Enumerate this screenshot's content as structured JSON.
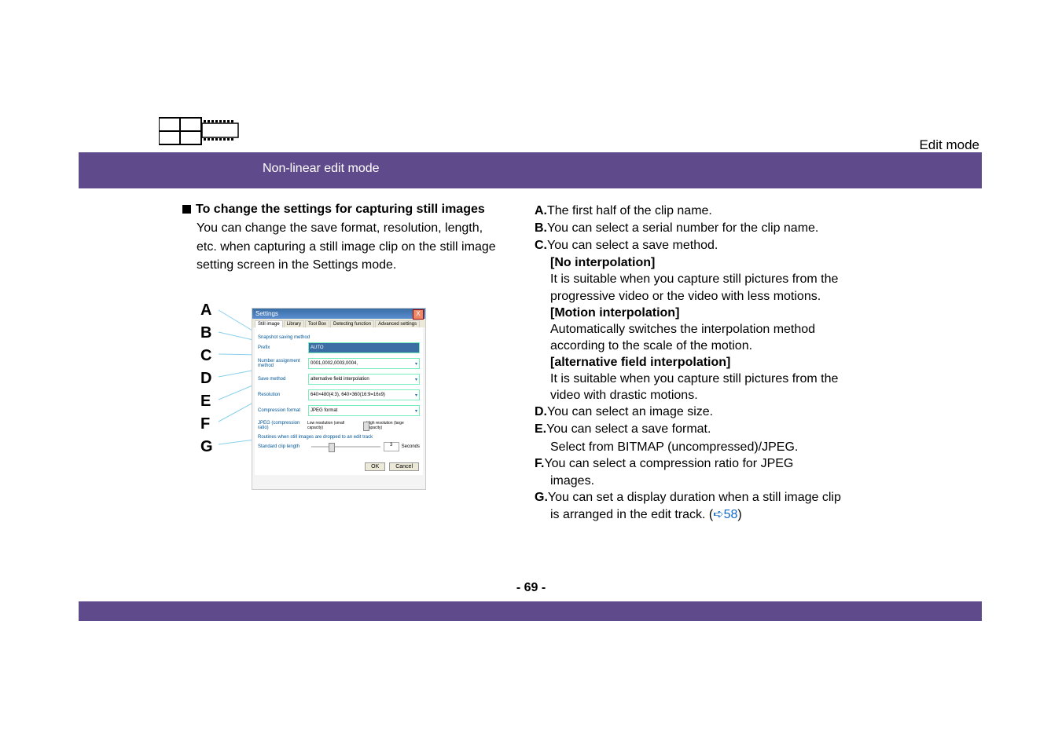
{
  "header": {
    "edit_mode": "Edit mode",
    "banner": "Non-linear edit mode"
  },
  "left": {
    "heading": "To change the settings for capturing still images",
    "para1": "You can change the save format, resolution, length,",
    "para2": "etc. when capturing a still image clip on the still image",
    "para3": "setting screen in the Settings mode."
  },
  "labels": {
    "A": "A",
    "B": "B",
    "C": "C",
    "D": "D",
    "E": "E",
    "F": "F",
    "G": "G"
  },
  "dialog": {
    "title": "Settings",
    "close": "X",
    "tabs": {
      "t1": "Still image",
      "t2": "Library",
      "t3": "Tool Box",
      "t4": "Detecting function",
      "t5": "Advanced settings"
    },
    "section1": "Snapshot saving method",
    "row_prefix": {
      "label": "Prefix",
      "value": "AUTO"
    },
    "row_number": {
      "label": "Number assignment method",
      "value": "0001,0002,0003,0004,"
    },
    "row_save": {
      "label": "Save method",
      "value": "alternative field interpolation"
    },
    "row_res": {
      "label": "Resolution",
      "value": "640×480(4:3), 640×360(16:9=16x9)"
    },
    "row_comp": {
      "label": "Compression format",
      "value": "JPEG format"
    },
    "row_jpeg": {
      "label": "JPEG (compression ratio)",
      "left": "Low resolution (small capacity)",
      "right": "High resolution (large capacity)"
    },
    "section2": "Routines when still images are dropped to an edit track",
    "row_std": {
      "label": "Standard clip length",
      "value": "3",
      "unit": "Seconds"
    },
    "ok": "OK",
    "cancel": "Cancel"
  },
  "right": {
    "A": {
      "lbl": "A.",
      "text": "The first half of the clip name."
    },
    "B": {
      "lbl": "B.",
      "text": "You can select a serial number for the clip name."
    },
    "C": {
      "lbl": "C.",
      "text": "You can select a save method.",
      "no_int_h": "[No interpolation]",
      "no_int_1": "It is suitable when you capture still pictures from the",
      "no_int_2": "progressive video or the video with less motions.",
      "mo_int_h": "[Motion interpolation]",
      "mo_int_1": "Automatically switches the interpolation method",
      "mo_int_2": "according to the scale of the motion.",
      "alt_h": "[alternative field interpolation]",
      "alt_1": "It is suitable when you capture still pictures from the",
      "alt_2": "video with drastic motions."
    },
    "D": {
      "lbl": "D.",
      "text": "You can select an image size."
    },
    "E": {
      "lbl": "E.",
      "text": "You can select a save format.",
      "sub": "Select from BITMAP (uncompressed)/JPEG."
    },
    "F": {
      "lbl": "F.",
      "text": "You can select a compression ratio for JPEG",
      "sub": "images."
    },
    "G": {
      "lbl": "G.",
      "pre": "You can set a display duration when a still image clip",
      "line2a": "is arranged in the edit track. (",
      "link": "58",
      "line2b": ")"
    }
  },
  "page": "- 69 -"
}
